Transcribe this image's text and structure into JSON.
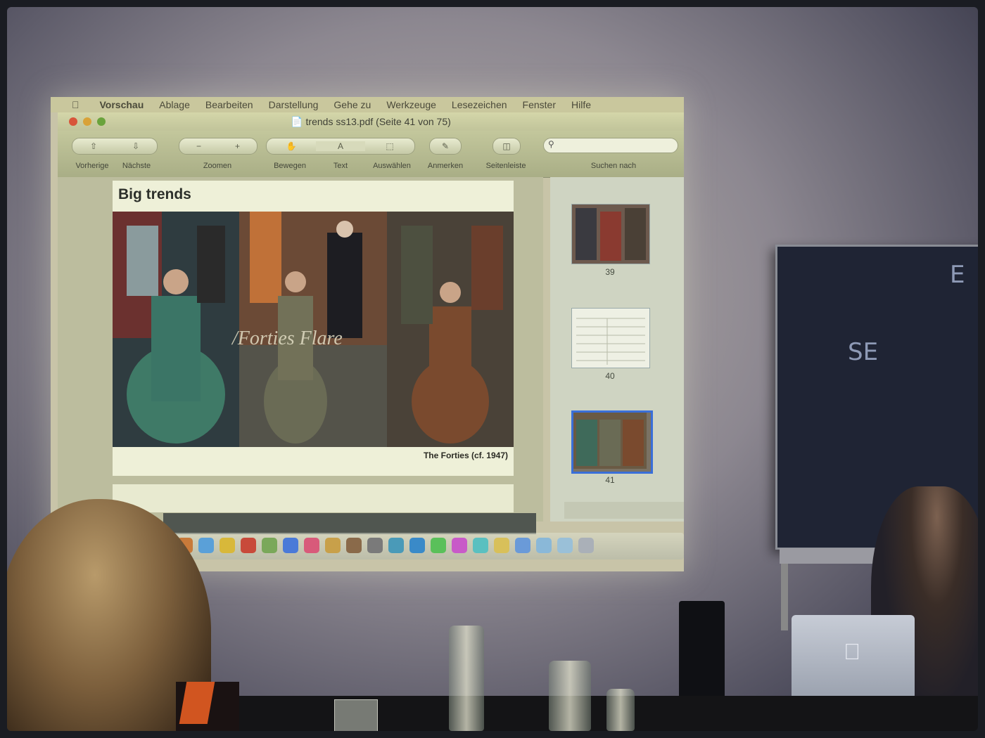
{
  "menubar": {
    "items": [
      "Vorschau",
      "Ablage",
      "Bearbeiten",
      "Darstellung",
      "Gehe zu",
      "Werkzeuge",
      "Lesezeichen",
      "Fenster",
      "Hilfe"
    ]
  },
  "window": {
    "title": "trends ss13.pdf (Seite 41 von 75)"
  },
  "toolbar": {
    "prev_label": "Vorherige",
    "next_label": "Nächste",
    "zoom_label": "Zoomen",
    "zoom_minus": "−",
    "zoom_plus": "+",
    "move_label": "Bewegen",
    "text_label": "Text",
    "select_label": "Auswählen",
    "annotate_label": "Anmerken",
    "sidebar_label": "Seitenleiste",
    "search_label": "Suchen nach"
  },
  "slide": {
    "title": "Big trends",
    "overlay_text": "/Forties Flare",
    "caption": "The Forties (cf. 1947)"
  },
  "thumbnails": [
    {
      "page": "39"
    },
    {
      "page": "40"
    },
    {
      "page": "41"
    }
  ],
  "blackboard": {
    "chalk1": "E",
    "chalk2": "SE"
  },
  "colors": {
    "projection": "#c8c4a8",
    "board": "#1f2434",
    "accent_selected_thumb": "#3a6fd8"
  }
}
